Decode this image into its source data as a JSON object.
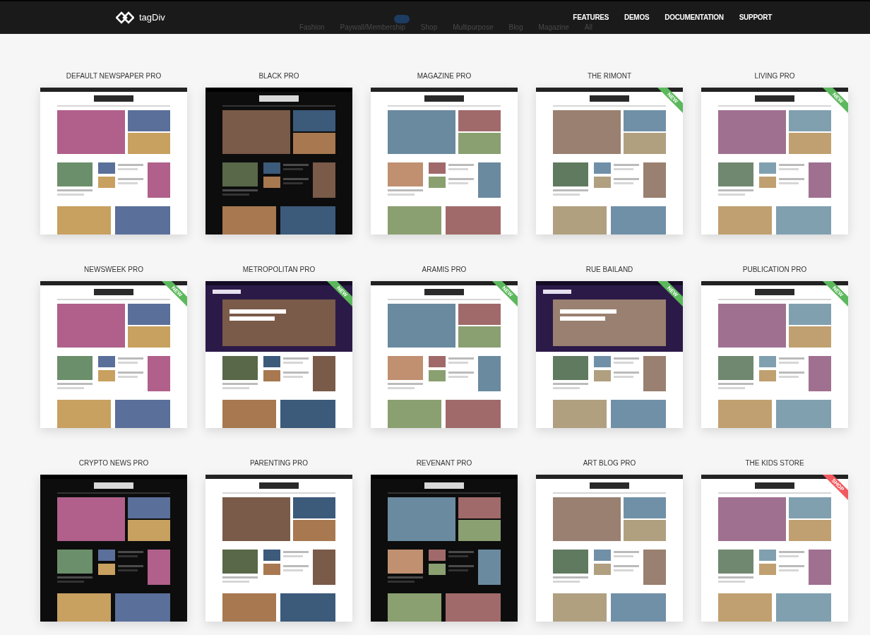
{
  "header": {
    "logo_text": "tagDiv",
    "nav": [
      "FEATURES",
      "DEMOS",
      "DOCUMENTATION",
      "SUPPORT"
    ]
  },
  "filters": [
    {
      "label": "Fashion",
      "badge": false
    },
    {
      "label": "Paywall/Membership",
      "badge": true
    },
    {
      "label": "Shop",
      "badge": false
    },
    {
      "label": "Multipurpose",
      "badge": false
    },
    {
      "label": "Blog",
      "badge": false
    },
    {
      "label": "Magazine",
      "badge": false
    },
    {
      "label": "All",
      "badge": false
    }
  ],
  "demos": [
    {
      "title": "DEFAULT NEWSPAPER PRO",
      "kind": "light"
    },
    {
      "title": "BLACK PRO",
      "kind": "dark"
    },
    {
      "title": "MAGAZINE PRO",
      "kind": "light"
    },
    {
      "title": "THE RIMONT",
      "kind": "light",
      "ribbon": {
        "label": "NEW",
        "color": "#5cb85c"
      }
    },
    {
      "title": "LIVING PRO",
      "kind": "light",
      "ribbon": {
        "label": "NEW",
        "color": "#5cb85c"
      }
    },
    {
      "title": "NEWSWEEK PRO",
      "kind": "light",
      "ribbon": {
        "label": "NEW",
        "color": "#5cb85c"
      }
    },
    {
      "title": "METROPOLITAN PRO",
      "kind": "split",
      "ribbon": {
        "label": "NEW",
        "color": "#5cb85c"
      }
    },
    {
      "title": "ARAMIS PRO",
      "kind": "light",
      "ribbon": {
        "label": "NEW",
        "color": "#5cb85c"
      }
    },
    {
      "title": "RUE BAILAND",
      "kind": "split",
      "ribbon": {
        "label": "NEW",
        "color": "#5cb85c"
      }
    },
    {
      "title": "PUBLICATION PRO",
      "kind": "light",
      "ribbon": {
        "label": "NEW",
        "color": "#5cb85c"
      }
    },
    {
      "title": "CRYPTO NEWS PRO",
      "kind": "dark"
    },
    {
      "title": "PARENTING PRO",
      "kind": "light"
    },
    {
      "title": "REVENANT PRO",
      "kind": "dark"
    },
    {
      "title": "ART BLOG PRO",
      "kind": "light"
    },
    {
      "title": "THE KIDS STORE",
      "kind": "light",
      "ribbon": {
        "label": "SHOP",
        "color": "#f25a5f"
      }
    }
  ]
}
